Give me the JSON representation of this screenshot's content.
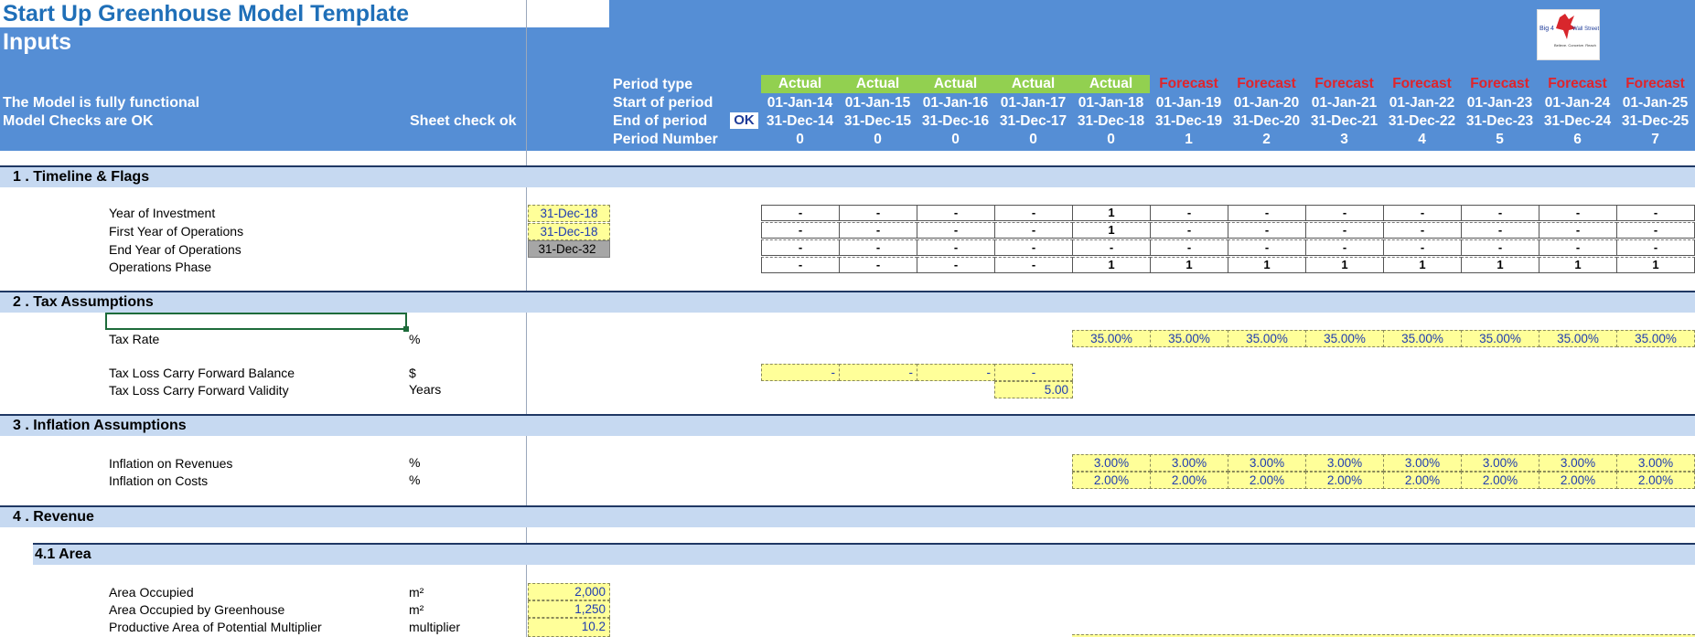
{
  "header": {
    "app_title": "Start Up Greenhouse Model Template",
    "sheet_title": "Inputs",
    "status_line1": "The Model is fully functional",
    "status_line2": "Model Checks are OK",
    "sheet_check": "Sheet check ok",
    "ok_badge": "OK",
    "logo_text": "Big 4 Wall Street",
    "row_labels": {
      "period_type": "Period type",
      "start_of_period": "Start of period",
      "end_of_period": "End of period",
      "period_number": "Period Number"
    }
  },
  "columns": [
    {
      "type": "Actual",
      "start": "01-Jan-14",
      "end": "31-Dec-14",
      "num": "0"
    },
    {
      "type": "Actual",
      "start": "01-Jan-15",
      "end": "31-Dec-15",
      "num": "0"
    },
    {
      "type": "Actual",
      "start": "01-Jan-16",
      "end": "31-Dec-16",
      "num": "0"
    },
    {
      "type": "Actual",
      "start": "01-Jan-17",
      "end": "31-Dec-17",
      "num": "0"
    },
    {
      "type": "Actual",
      "start": "01-Jan-18",
      "end": "31-Dec-18",
      "num": "0"
    },
    {
      "type": "Forecast",
      "start": "01-Jan-19",
      "end": "31-Dec-19",
      "num": "1"
    },
    {
      "type": "Forecast",
      "start": "01-Jan-20",
      "end": "31-Dec-20",
      "num": "2"
    },
    {
      "type": "Forecast",
      "start": "01-Jan-21",
      "end": "31-Dec-21",
      "num": "3"
    },
    {
      "type": "Forecast",
      "start": "01-Jan-22",
      "end": "31-Dec-22",
      "num": "4"
    },
    {
      "type": "Forecast",
      "start": "01-Jan-23",
      "end": "31-Dec-23",
      "num": "5"
    },
    {
      "type": "Forecast",
      "start": "01-Jan-24",
      "end": "31-Dec-24",
      "num": "6"
    },
    {
      "type": "Forecast",
      "start": "01-Jan-25",
      "end": "31-Dec-25",
      "num": "7"
    }
  ],
  "sections": {
    "timeline": {
      "title": "1 .  Timeline & Flags",
      "rows": [
        {
          "label": "Year of Investment",
          "input": "31-Dec-18",
          "flags": [
            "-",
            "-",
            "-",
            "-",
            "1",
            "-",
            "-",
            "-",
            "-",
            "-",
            "-",
            "-"
          ]
        },
        {
          "label": "First Year of Operations",
          "input": "31-Dec-18",
          "flags": [
            "-",
            "-",
            "-",
            "-",
            "1",
            "-",
            "-",
            "-",
            "-",
            "-",
            "-",
            "-"
          ]
        },
        {
          "label": "End Year of Operations",
          "input": "31-Dec-32",
          "flags": [
            "-",
            "-",
            "-",
            "-",
            "-",
            "-",
            "-",
            "-",
            "-",
            "-",
            "-",
            "-"
          ]
        },
        {
          "label": "Operations Phase",
          "input": "",
          "flags": [
            "-",
            "-",
            "-",
            "-",
            "1",
            "1",
            "1",
            "1",
            "1",
            "1",
            "1",
            "1"
          ]
        }
      ]
    },
    "tax": {
      "title": "2 .  Tax Assumptions",
      "tax_rate": {
        "label": "Tax Rate",
        "unit": "%",
        "values": [
          "35.00%",
          "35.00%",
          "35.00%",
          "35.00%",
          "35.00%",
          "35.00%",
          "35.00%",
          "35.00%"
        ]
      },
      "tlcf_balance": {
        "label": "Tax Loss Carry Forward Balance",
        "unit": "$",
        "values": [
          "-",
          "-",
          "-",
          "-"
        ]
      },
      "tlcf_validity": {
        "label": "Tax Loss Carry Forward Validity",
        "unit": "Years",
        "value": "5.00"
      }
    },
    "inflation": {
      "title": "3 .  Inflation Assumptions",
      "revenues": {
        "label": "Inflation on Revenues",
        "unit": "%",
        "values": [
          "3.00%",
          "3.00%",
          "3.00%",
          "3.00%",
          "3.00%",
          "3.00%",
          "3.00%",
          "3.00%"
        ]
      },
      "costs": {
        "label": "Inflation on Costs",
        "unit": "%",
        "values": [
          "2.00%",
          "2.00%",
          "2.00%",
          "2.00%",
          "2.00%",
          "2.00%",
          "2.00%",
          "2.00%"
        ]
      }
    },
    "revenue": {
      "title": "4 .  Revenue",
      "sub_title": "4.1    Area",
      "rows": [
        {
          "label": "Area Occupied",
          "unit": "m²",
          "value": "2,000"
        },
        {
          "label": "Area Occupied by Greenhouse",
          "unit": "m²",
          "value": "1,250"
        },
        {
          "label": "Productive Area of Potential Multiplier",
          "unit": "multiplier",
          "value": "10.2"
        }
      ]
    }
  },
  "colors": {
    "header_blue": "#558ED5",
    "title_blue": "#1F6FB8",
    "actual_green": "#92D050",
    "forecast_red": "#E0242B",
    "input_yellow": "#FFFF99",
    "section_band": "#C6D9F1"
  }
}
